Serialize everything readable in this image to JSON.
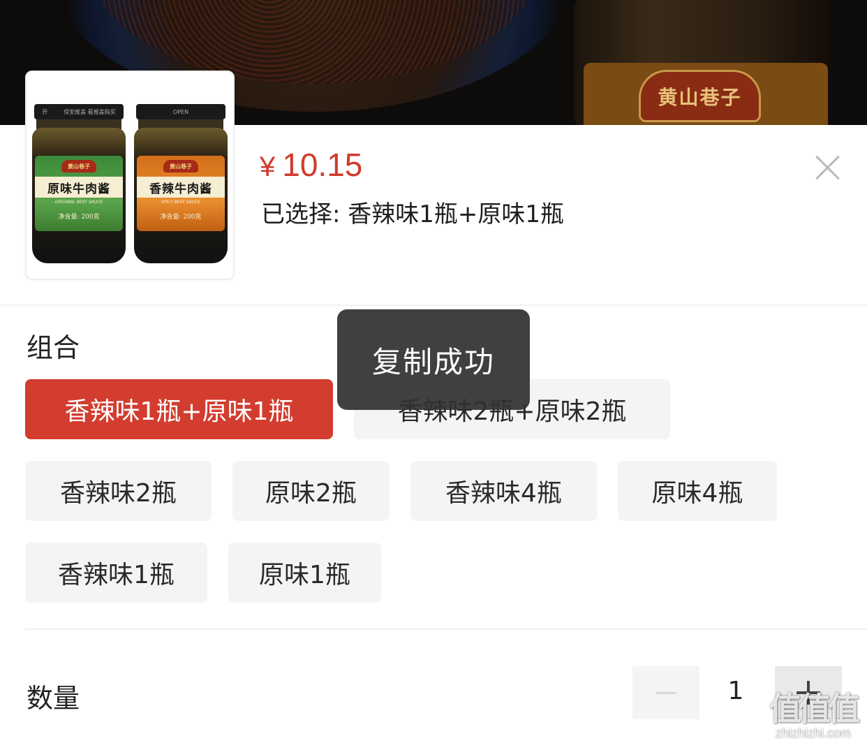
{
  "backdrop": {
    "jar_badge_text": "黄山巷子"
  },
  "product": {
    "price_symbol": "¥",
    "price": "10.15",
    "selected_text": "已选择: 香辣味1瓶+原味1瓶",
    "thumbnail": {
      "left_jar": {
        "brand": "黄山巷子",
        "name": "原味牛肉酱",
        "subtitle": "ORIGINAL BEEF SAUCE",
        "net": "净含量: 200克",
        "lid_text_1": "开",
        "lid_text_2": "保安推盖 看推盖购买"
      },
      "right_jar": {
        "brand": "黄山巷子",
        "name": "香辣牛肉酱",
        "subtitle": "SPICY BEEF SAUCE",
        "net": "净含量: 200克",
        "lid_text_1": "OPEN"
      }
    }
  },
  "combo": {
    "title": "组合",
    "options": [
      {
        "label": "香辣味1瓶+原味1瓶",
        "selected": true
      },
      {
        "label": "香辣味2瓶+原味2瓶",
        "selected": false
      },
      {
        "label": "香辣味2瓶",
        "selected": false
      },
      {
        "label": "原味2瓶",
        "selected": false
      },
      {
        "label": "香辣味4瓶",
        "selected": false
      },
      {
        "label": "原味4瓶",
        "selected": false
      },
      {
        "label": "香辣味1瓶",
        "selected": false
      },
      {
        "label": "原味1瓶",
        "selected": false
      }
    ]
  },
  "quantity": {
    "title": "数量",
    "value": "1"
  },
  "toast": {
    "message": "复制成功"
  },
  "watermark": {
    "main": "值值值",
    "sub": "zhizhizhi.com"
  },
  "colors": {
    "accent": "#d23d2f",
    "price": "#d03a2c",
    "option_bg": "#f4f4f4"
  }
}
